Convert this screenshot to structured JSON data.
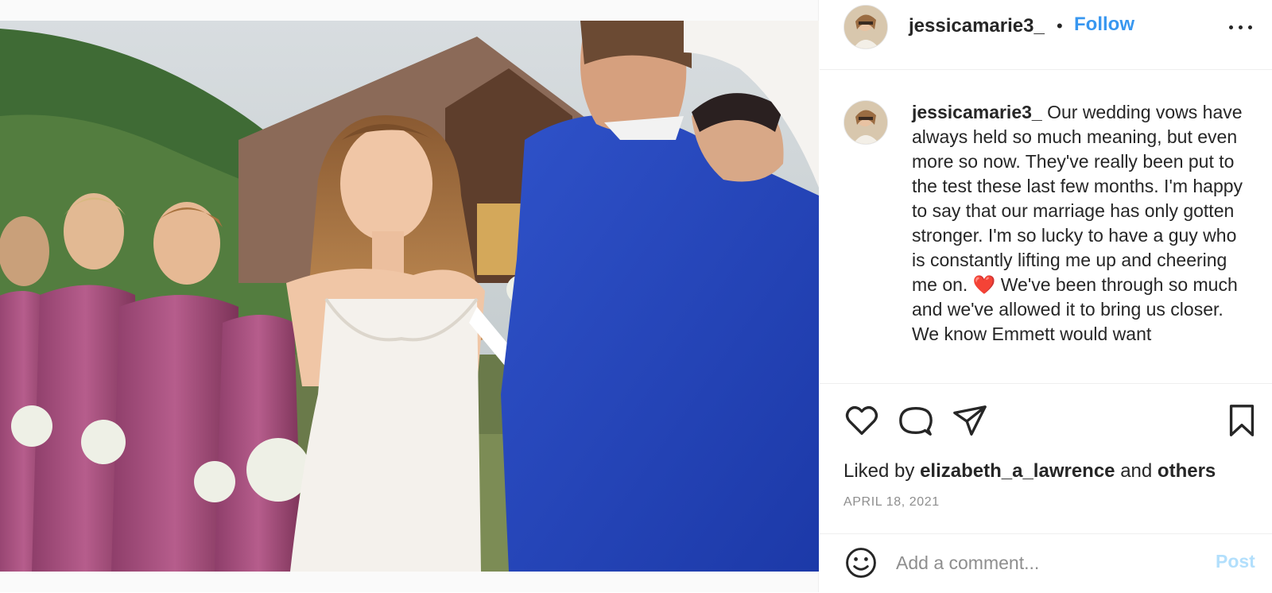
{
  "post": {
    "username": "jessicamarie3_",
    "follow_label": "Follow",
    "separator": "•",
    "caption": "Our wedding vows have always held so much meaning, but even more so now. They've really been put to the test these last few months. I'm happy to say that our marriage has only gotten stronger. I'm so lucky to have a guy who is constantly lifting me up and cheering me on. ❤️ We've been through so much and we've allowed it to bring us closer. We know Emmett would want",
    "liked_by_prefix": "Liked by",
    "liked_by_user": "elizabeth_a_lawrence",
    "liked_by_and": "and",
    "liked_by_others": "others",
    "date": "APRIL 18, 2021"
  },
  "icons": {
    "more": "more-options-icon",
    "like": "heart-icon",
    "comment": "comment-bubble-icon",
    "share": "paper-plane-icon",
    "save": "bookmark-icon",
    "emoji": "smiley-icon"
  },
  "comment_box": {
    "placeholder": "Add a comment...",
    "post_label": "Post"
  },
  "colors": {
    "accent": "#3897f0",
    "post_disabled": "#b2dffc",
    "muted": "#8e8e8e"
  }
}
